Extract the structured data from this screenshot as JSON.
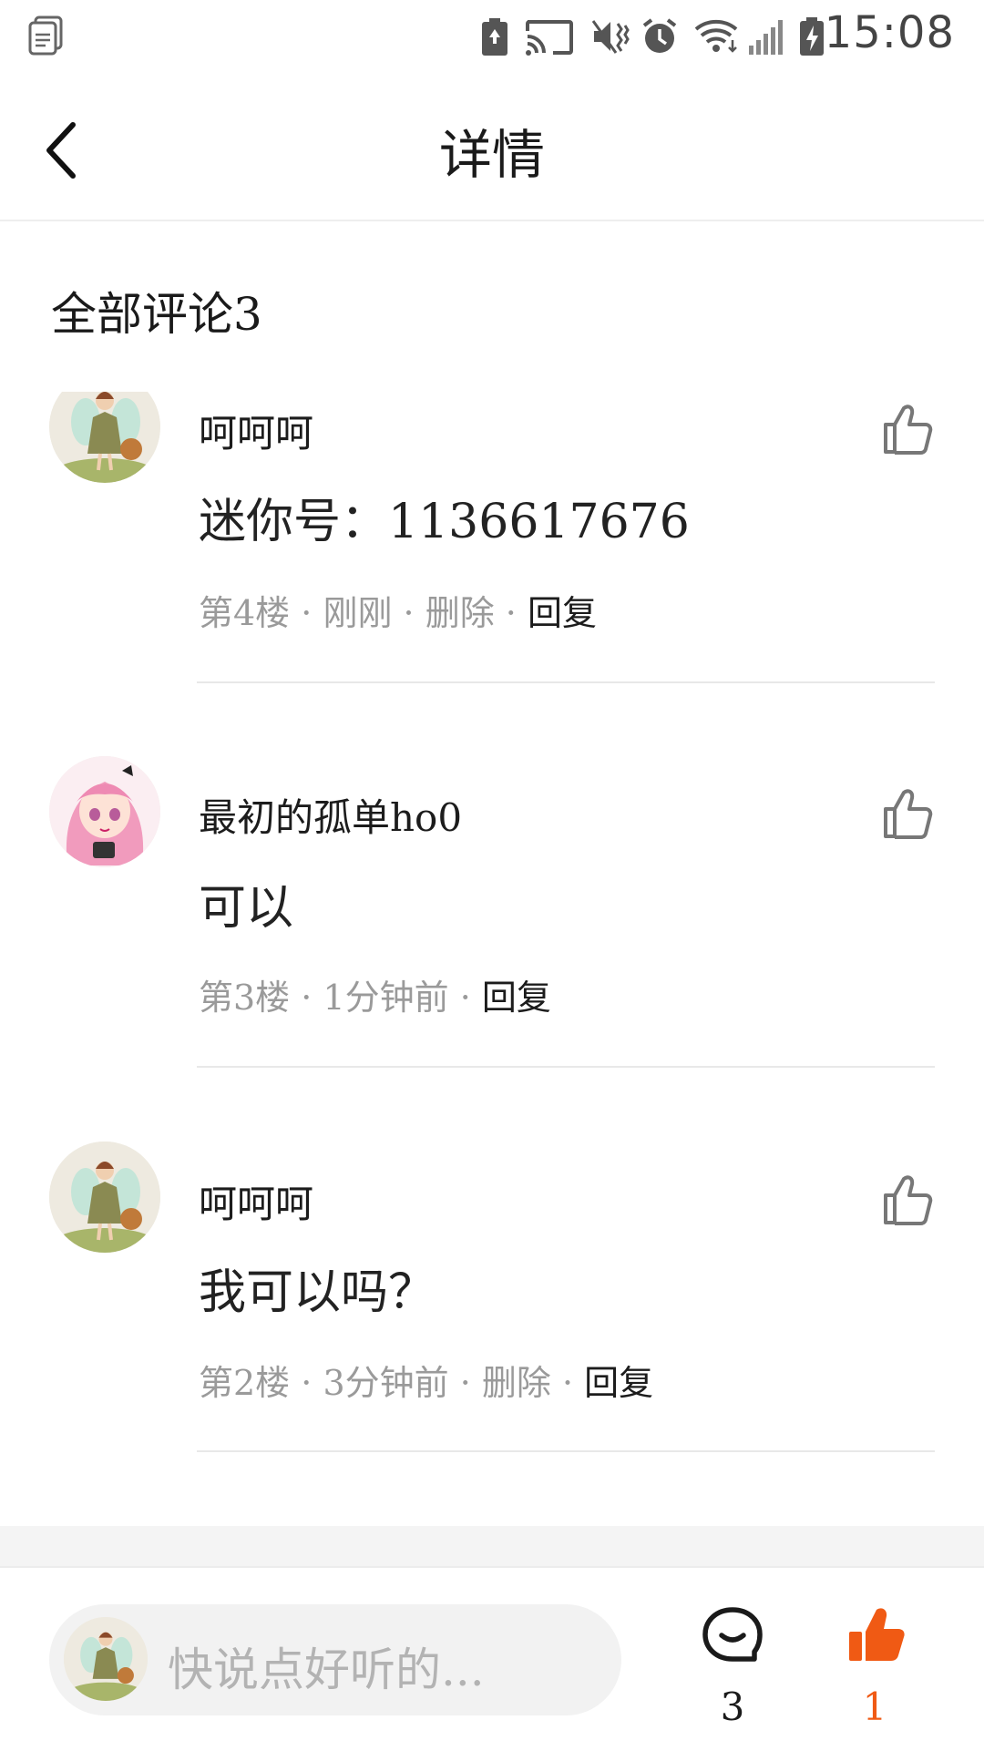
{
  "status_bar": {
    "time": "15:08",
    "icons": [
      "clipboard-icon",
      "battery-saver-icon",
      "cast-icon",
      "vibrate-icon",
      "alarm-icon",
      "wifi-icon",
      "signal-icon",
      "battery-charging-icon"
    ]
  },
  "header": {
    "title": "详情",
    "back_icon": "chevron-left-icon"
  },
  "comments_section": {
    "title": "全部评论3"
  },
  "comments": [
    {
      "username": "呵呵呵",
      "content": "迷你号：1136617676",
      "floor": "第4楼",
      "time": "刚刚",
      "delete": "删除",
      "reply": "回复",
      "sep": " · "
    },
    {
      "username": "最初的孤单ho0",
      "content": "可以",
      "floor": "第3楼",
      "time": "1分钟前",
      "reply": "回复",
      "sep": " · "
    },
    {
      "username": "呵呵呵",
      "content": "我可以吗？",
      "floor": "第2楼",
      "time": "3分钟前",
      "delete": "删除",
      "reply": "回复",
      "sep": " · "
    }
  ],
  "bottom_bar": {
    "input_placeholder": "快说点好听的...",
    "comment_count": "3",
    "like_count": "1",
    "accent_color": "#f05a14"
  }
}
